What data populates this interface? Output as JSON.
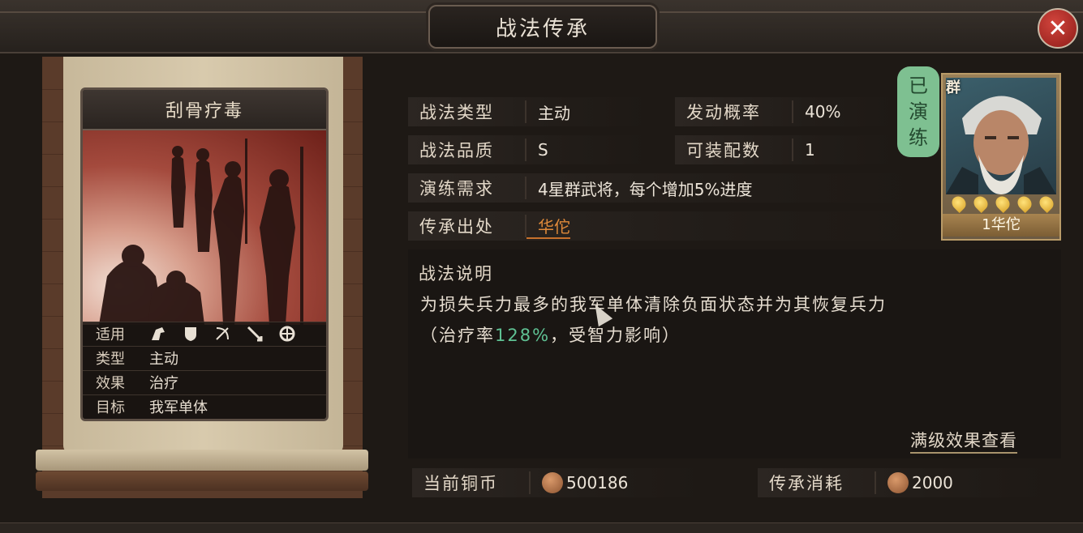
{
  "window": {
    "title": "战法传承",
    "close_label": "✕"
  },
  "card": {
    "name": "刮骨疗毒",
    "rows": [
      {
        "key": "适用",
        "value": ""
      },
      {
        "key": "类型",
        "value": "主动"
      },
      {
        "key": "效果",
        "value": "治疗"
      },
      {
        "key": "目标",
        "value": "我军单体"
      }
    ],
    "troop_icons": [
      "cavalry-icon",
      "shield-icon",
      "bow-icon",
      "spear-icon",
      "siege-icon"
    ]
  },
  "fields": {
    "type": {
      "label": "战法类型",
      "value": "主动"
    },
    "chance": {
      "label": "发动概率",
      "value": "40%"
    },
    "quality": {
      "label": "战法品质",
      "value": "S"
    },
    "equip": {
      "label": "可装配数",
      "value": "1"
    },
    "practice": {
      "label": "演练需求",
      "value": "4星群武将，每个增加5%进度"
    },
    "source": {
      "label": "传承出处",
      "value": "华佗"
    }
  },
  "stamp": {
    "chars": [
      "已",
      "演",
      "练"
    ]
  },
  "hero": {
    "faction": "群",
    "name": "1华佗",
    "stars": 5
  },
  "description": {
    "title": "战法说明",
    "line1": "为损失兵力最多的我军单体清除负面状态并为其恢复兵力",
    "line2_pre": "（治疗率",
    "line2_value": "128%",
    "line2_post": "，受智力影响）",
    "more_link": "满级效果查看"
  },
  "currency": {
    "current": {
      "label": "当前铜币",
      "value": "500186"
    },
    "cost": {
      "label": "传承消耗",
      "value": "2000"
    }
  },
  "colors": {
    "accent_orange": "#e08a3a",
    "heal_green": "#5fc193",
    "stamp_green": "#7ec091",
    "close_red": "#c2302a"
  }
}
